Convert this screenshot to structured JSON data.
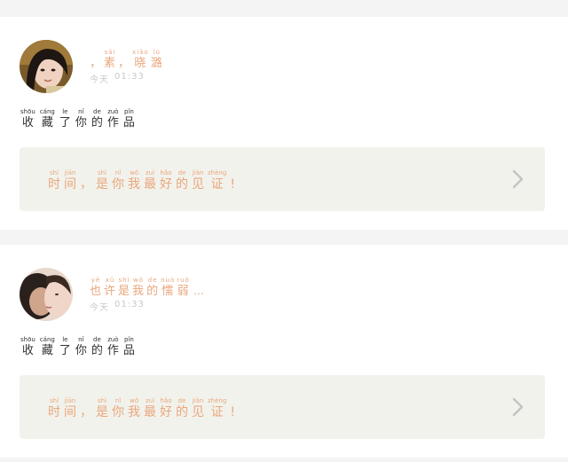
{
  "posts": [
    {
      "nickname": [
        {
          "py": "",
          "ch": "，"
        },
        {
          "py": "sāi",
          "ch": "素"
        },
        {
          "py": "",
          "ch": "，"
        },
        {
          "py": "xiǎo",
          "ch": "晓"
        },
        {
          "py": "lù",
          "ch": "潞"
        }
      ],
      "time_label": "今天",
      "time_value": "01:33",
      "action": [
        {
          "py": "shōu",
          "ch": "收"
        },
        {
          "py": "cáng",
          "ch": "藏"
        },
        {
          "py": "le",
          "ch": "了"
        },
        {
          "py": "nǐ",
          "ch": "你"
        },
        {
          "py": "de",
          "ch": "的"
        },
        {
          "py": "zuò",
          "ch": "作"
        },
        {
          "py": "pǐn",
          "ch": "品"
        }
      ],
      "quote": [
        {
          "py": "shí",
          "ch": "时"
        },
        {
          "py": "jiān",
          "ch": "间"
        },
        {
          "py": "",
          "ch": "，"
        },
        {
          "py": "shì",
          "ch": "是"
        },
        {
          "py": "nǐ",
          "ch": "你"
        },
        {
          "py": "wǒ",
          "ch": "我"
        },
        {
          "py": "zuì",
          "ch": "最"
        },
        {
          "py": "hǎo",
          "ch": "好"
        },
        {
          "py": "de",
          "ch": "的"
        },
        {
          "py": "jiàn",
          "ch": "见"
        },
        {
          "py": "zhèng",
          "ch": "证"
        },
        {
          "py": "",
          "ch": "!"
        }
      ]
    },
    {
      "nickname": [
        {
          "py": "yě",
          "ch": "也"
        },
        {
          "py": "xǔ",
          "ch": "许"
        },
        {
          "py": "shì",
          "ch": "是"
        },
        {
          "py": "wǒ",
          "ch": "我"
        },
        {
          "py": "de",
          "ch": "的"
        },
        {
          "py": "nuò",
          "ch": "懦"
        },
        {
          "py": "ruò",
          "ch": "弱"
        }
      ],
      "nickname_suffix": "…",
      "time_label": "今天",
      "time_value": "01:33",
      "action": [
        {
          "py": "shōu",
          "ch": "收"
        },
        {
          "py": "cáng",
          "ch": "藏"
        },
        {
          "py": "le",
          "ch": "了"
        },
        {
          "py": "nǐ",
          "ch": "你"
        },
        {
          "py": "de",
          "ch": "的"
        },
        {
          "py": "zuò",
          "ch": "作"
        },
        {
          "py": "pǐn",
          "ch": "品"
        }
      ],
      "quote": [
        {
          "py": "shí",
          "ch": "时"
        },
        {
          "py": "jiān",
          "ch": "间"
        },
        {
          "py": "",
          "ch": "，"
        },
        {
          "py": "shì",
          "ch": "是"
        },
        {
          "py": "nǐ",
          "ch": "你"
        },
        {
          "py": "wǒ",
          "ch": "我"
        },
        {
          "py": "zuì",
          "ch": "最"
        },
        {
          "py": "hǎo",
          "ch": "好"
        },
        {
          "py": "de",
          "ch": "的"
        },
        {
          "py": "jiàn",
          "ch": "见"
        },
        {
          "py": "zhèng",
          "ch": "证"
        },
        {
          "py": "",
          "ch": "!"
        }
      ]
    }
  ],
  "icons": {
    "avatar_1": "user-avatar-icon",
    "avatar_2": "user-avatar-icon",
    "chevron": "chevron-right-icon"
  },
  "colors": {
    "accent": "#e9a77c",
    "muted": "#c9c9c9",
    "text": "#333333",
    "quote_bg": "#f2f2ec"
  }
}
